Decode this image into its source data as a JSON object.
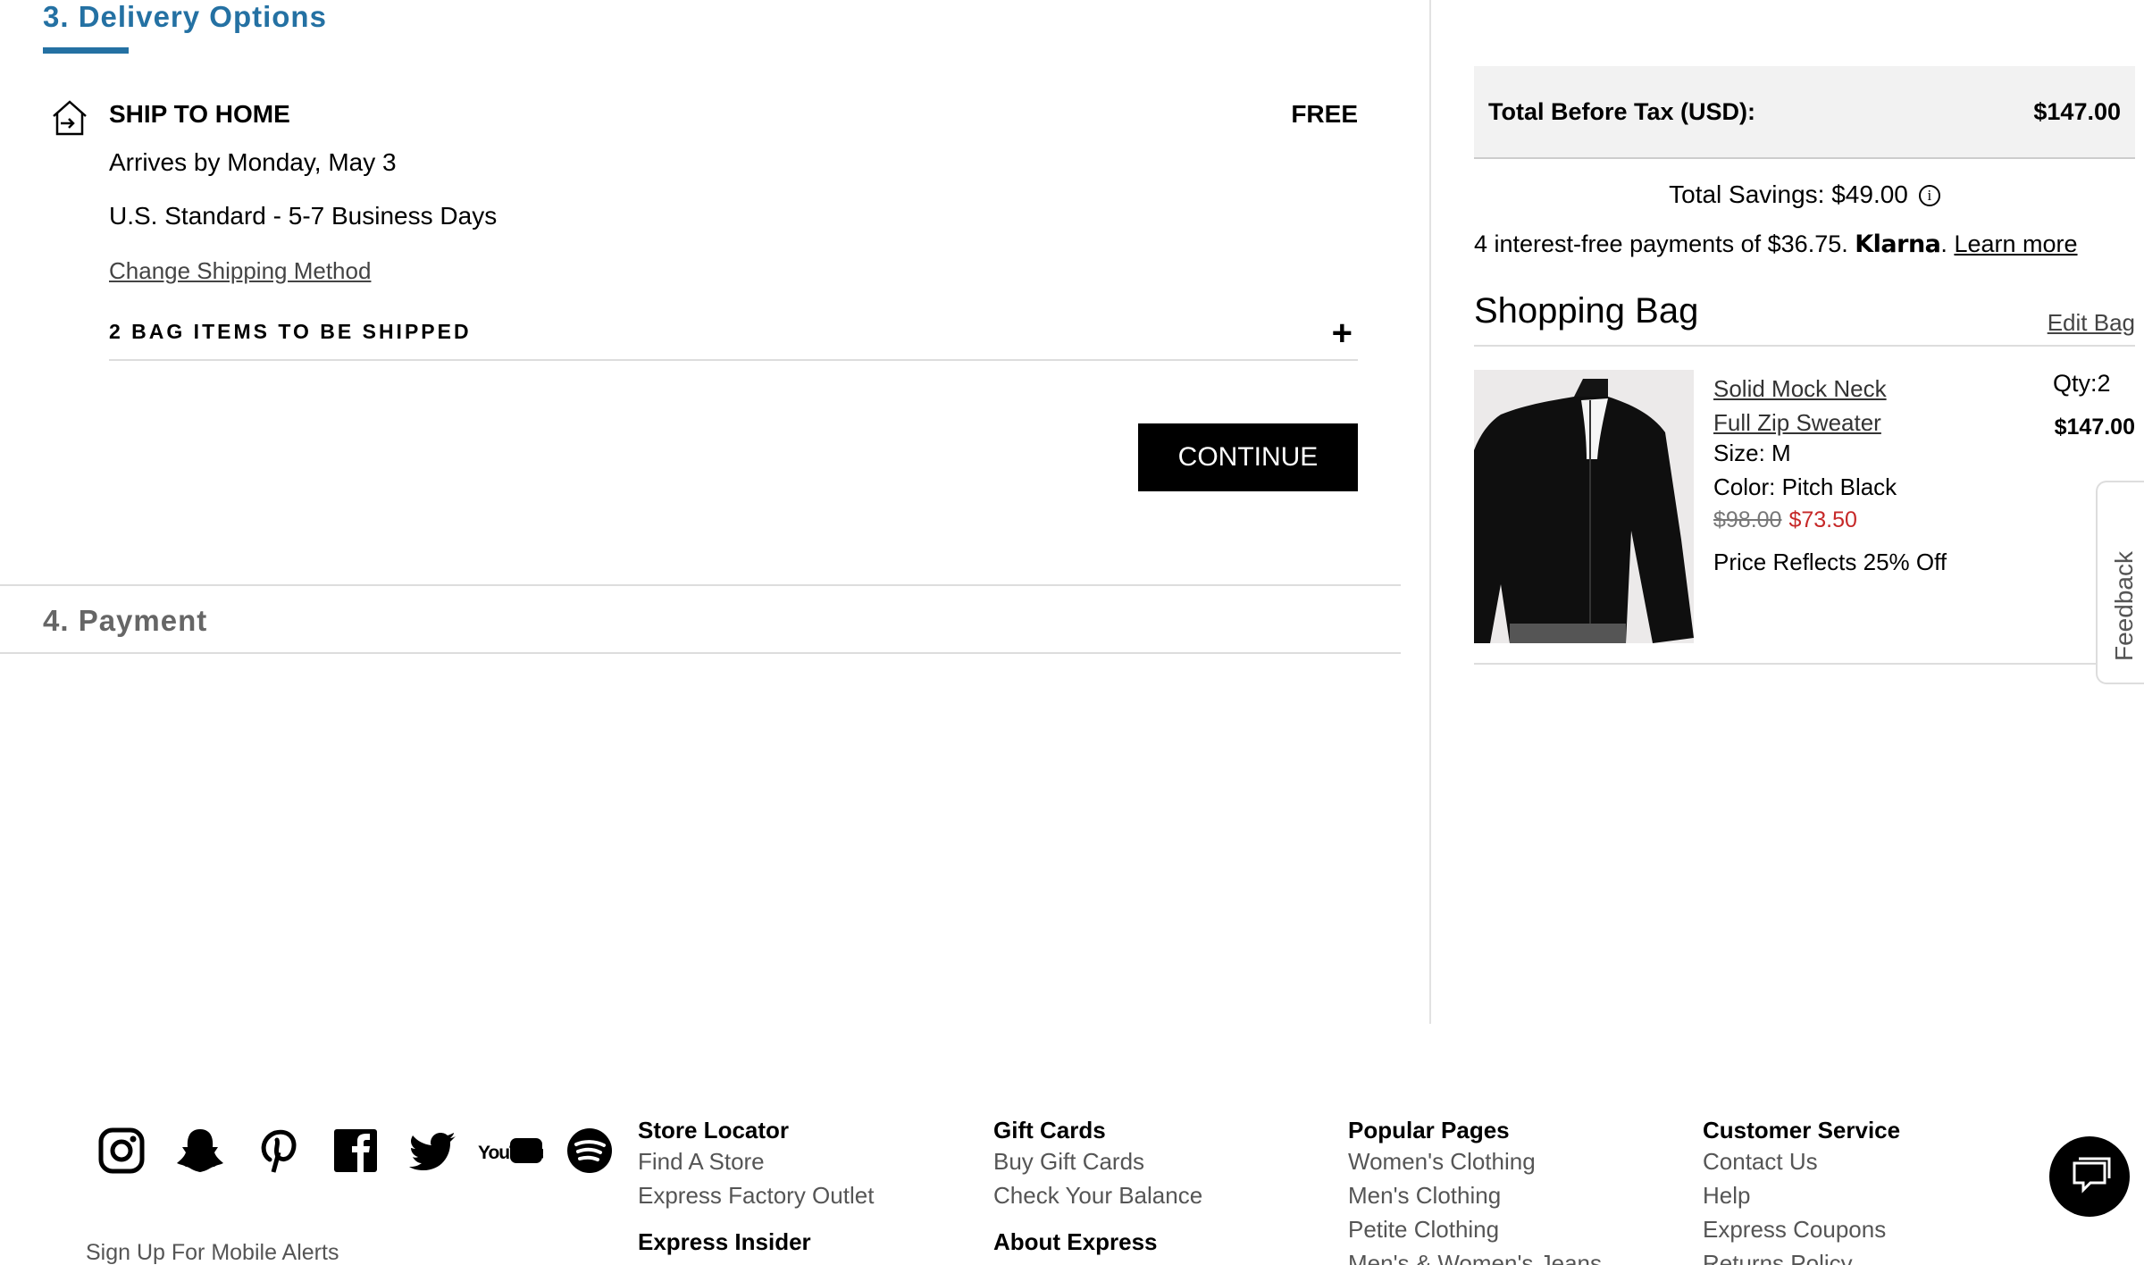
{
  "delivery": {
    "step_title": "3. Delivery Options",
    "ship_title": "SHIP TO HOME",
    "ship_price": "FREE",
    "arrives": "Arrives by Monday, May 3",
    "method": "U.S. Standard - 5-7 Business Days",
    "change_method": "Change Shipping Method",
    "bag_items": "2 BAG ITEMS TO BE SHIPPED",
    "expand_symbol": "+",
    "continue_label": "CONTINUE"
  },
  "payment": {
    "step_title": "4. Payment"
  },
  "summary": {
    "total_label": "Total Before Tax (USD):",
    "total_value": "$147.00",
    "savings": "Total Savings: $49.00",
    "info_glyph": "i",
    "klarna_text": "4 interest-free payments of $36.75. ",
    "klarna_brand": "Klarna",
    "klarna_dot": ".",
    "klarna_learn": "Learn more"
  },
  "bag": {
    "title": "Shopping Bag",
    "edit_label": "Edit Bag",
    "item": {
      "name": "Solid Mock Neck Full Zip Sweater",
      "size": "Size: M",
      "color": "Color: Pitch Black",
      "original_price": "$98.00",
      "sale_price": "$73.50",
      "discount_note": "Price Reflects 25% Off",
      "qty": "Qty:2",
      "line_total": "$147.00"
    }
  },
  "feedback": {
    "label": "Feedback"
  },
  "footer": {
    "social_icons": [
      "instagram-icon",
      "snapchat-icon",
      "pinterest-icon",
      "facebook-icon",
      "twitter-icon",
      "youtube-icon",
      "spotify-icon"
    ],
    "youtube_text": "YouTube",
    "mobile_alerts": "Sign Up For Mobile Alerts",
    "col1": {
      "title": "Store Locator",
      "links": [
        "Find A Store",
        "Express Factory Outlet"
      ],
      "next_title": "Express Insider"
    },
    "col2": {
      "title": "Gift Cards",
      "links": [
        "Buy Gift Cards",
        "Check Your Balance"
      ],
      "next_title": "About Express"
    },
    "col3": {
      "title": "Popular Pages",
      "links": [
        "Women's Clothing",
        "Men's Clothing",
        "Petite Clothing",
        "Men's & Women's Jeans"
      ]
    },
    "col4": {
      "title": "Customer Service",
      "links": [
        "Contact Us",
        "Help",
        "Express Coupons",
        "Returns Policy"
      ]
    }
  },
  "colors": {
    "accent": "#2471a3",
    "sale": "#c62828",
    "button": "#000000"
  }
}
